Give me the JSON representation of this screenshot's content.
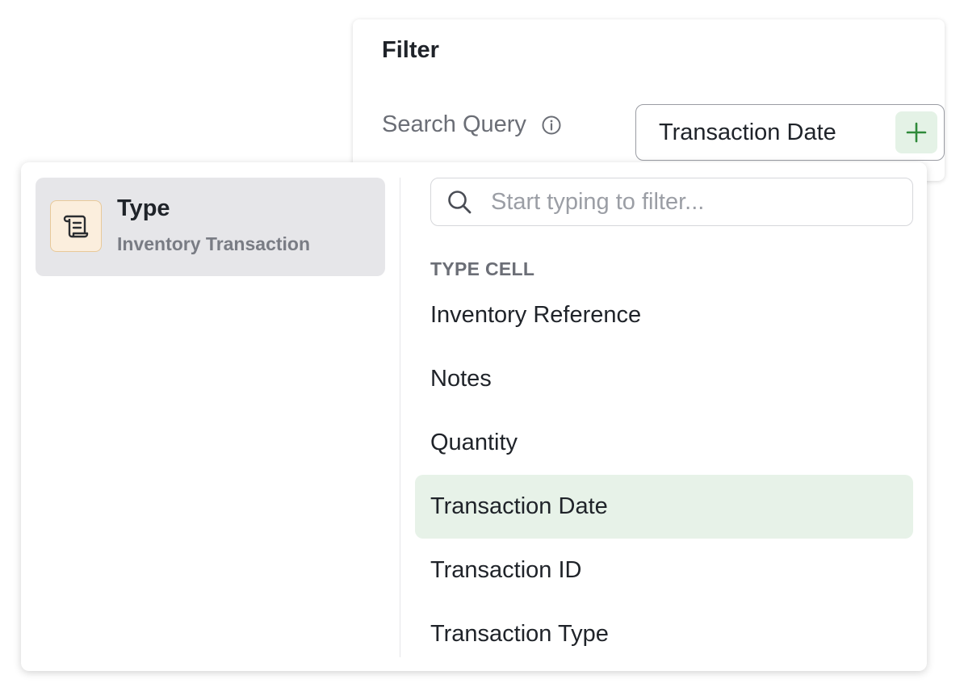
{
  "filter": {
    "title": "Filter",
    "search_query_label": "Search Query",
    "chip_label": "Transaction Date"
  },
  "type_item": {
    "title": "Type",
    "subtitle": "Inventory Transaction"
  },
  "search": {
    "placeholder": "Start typing to filter..."
  },
  "section_header": "TYPE CELL",
  "options": [
    {
      "label": "Inventory Reference",
      "selected": false
    },
    {
      "label": "Notes",
      "selected": false
    },
    {
      "label": "Quantity",
      "selected": false
    },
    {
      "label": "Transaction Date",
      "selected": true
    },
    {
      "label": "Transaction ID",
      "selected": false
    },
    {
      "label": "Transaction Type",
      "selected": false
    }
  ],
  "icons": {
    "info": "info-icon",
    "add": "plus-icon",
    "type": "scroll-icon",
    "search": "search-icon"
  },
  "colors": {
    "selected_bg": "#e7f2e8",
    "add_button_bg": "#e4f2e6",
    "add_icon": "#2f8a3a",
    "type_icon_bg": "#fbeedd"
  }
}
